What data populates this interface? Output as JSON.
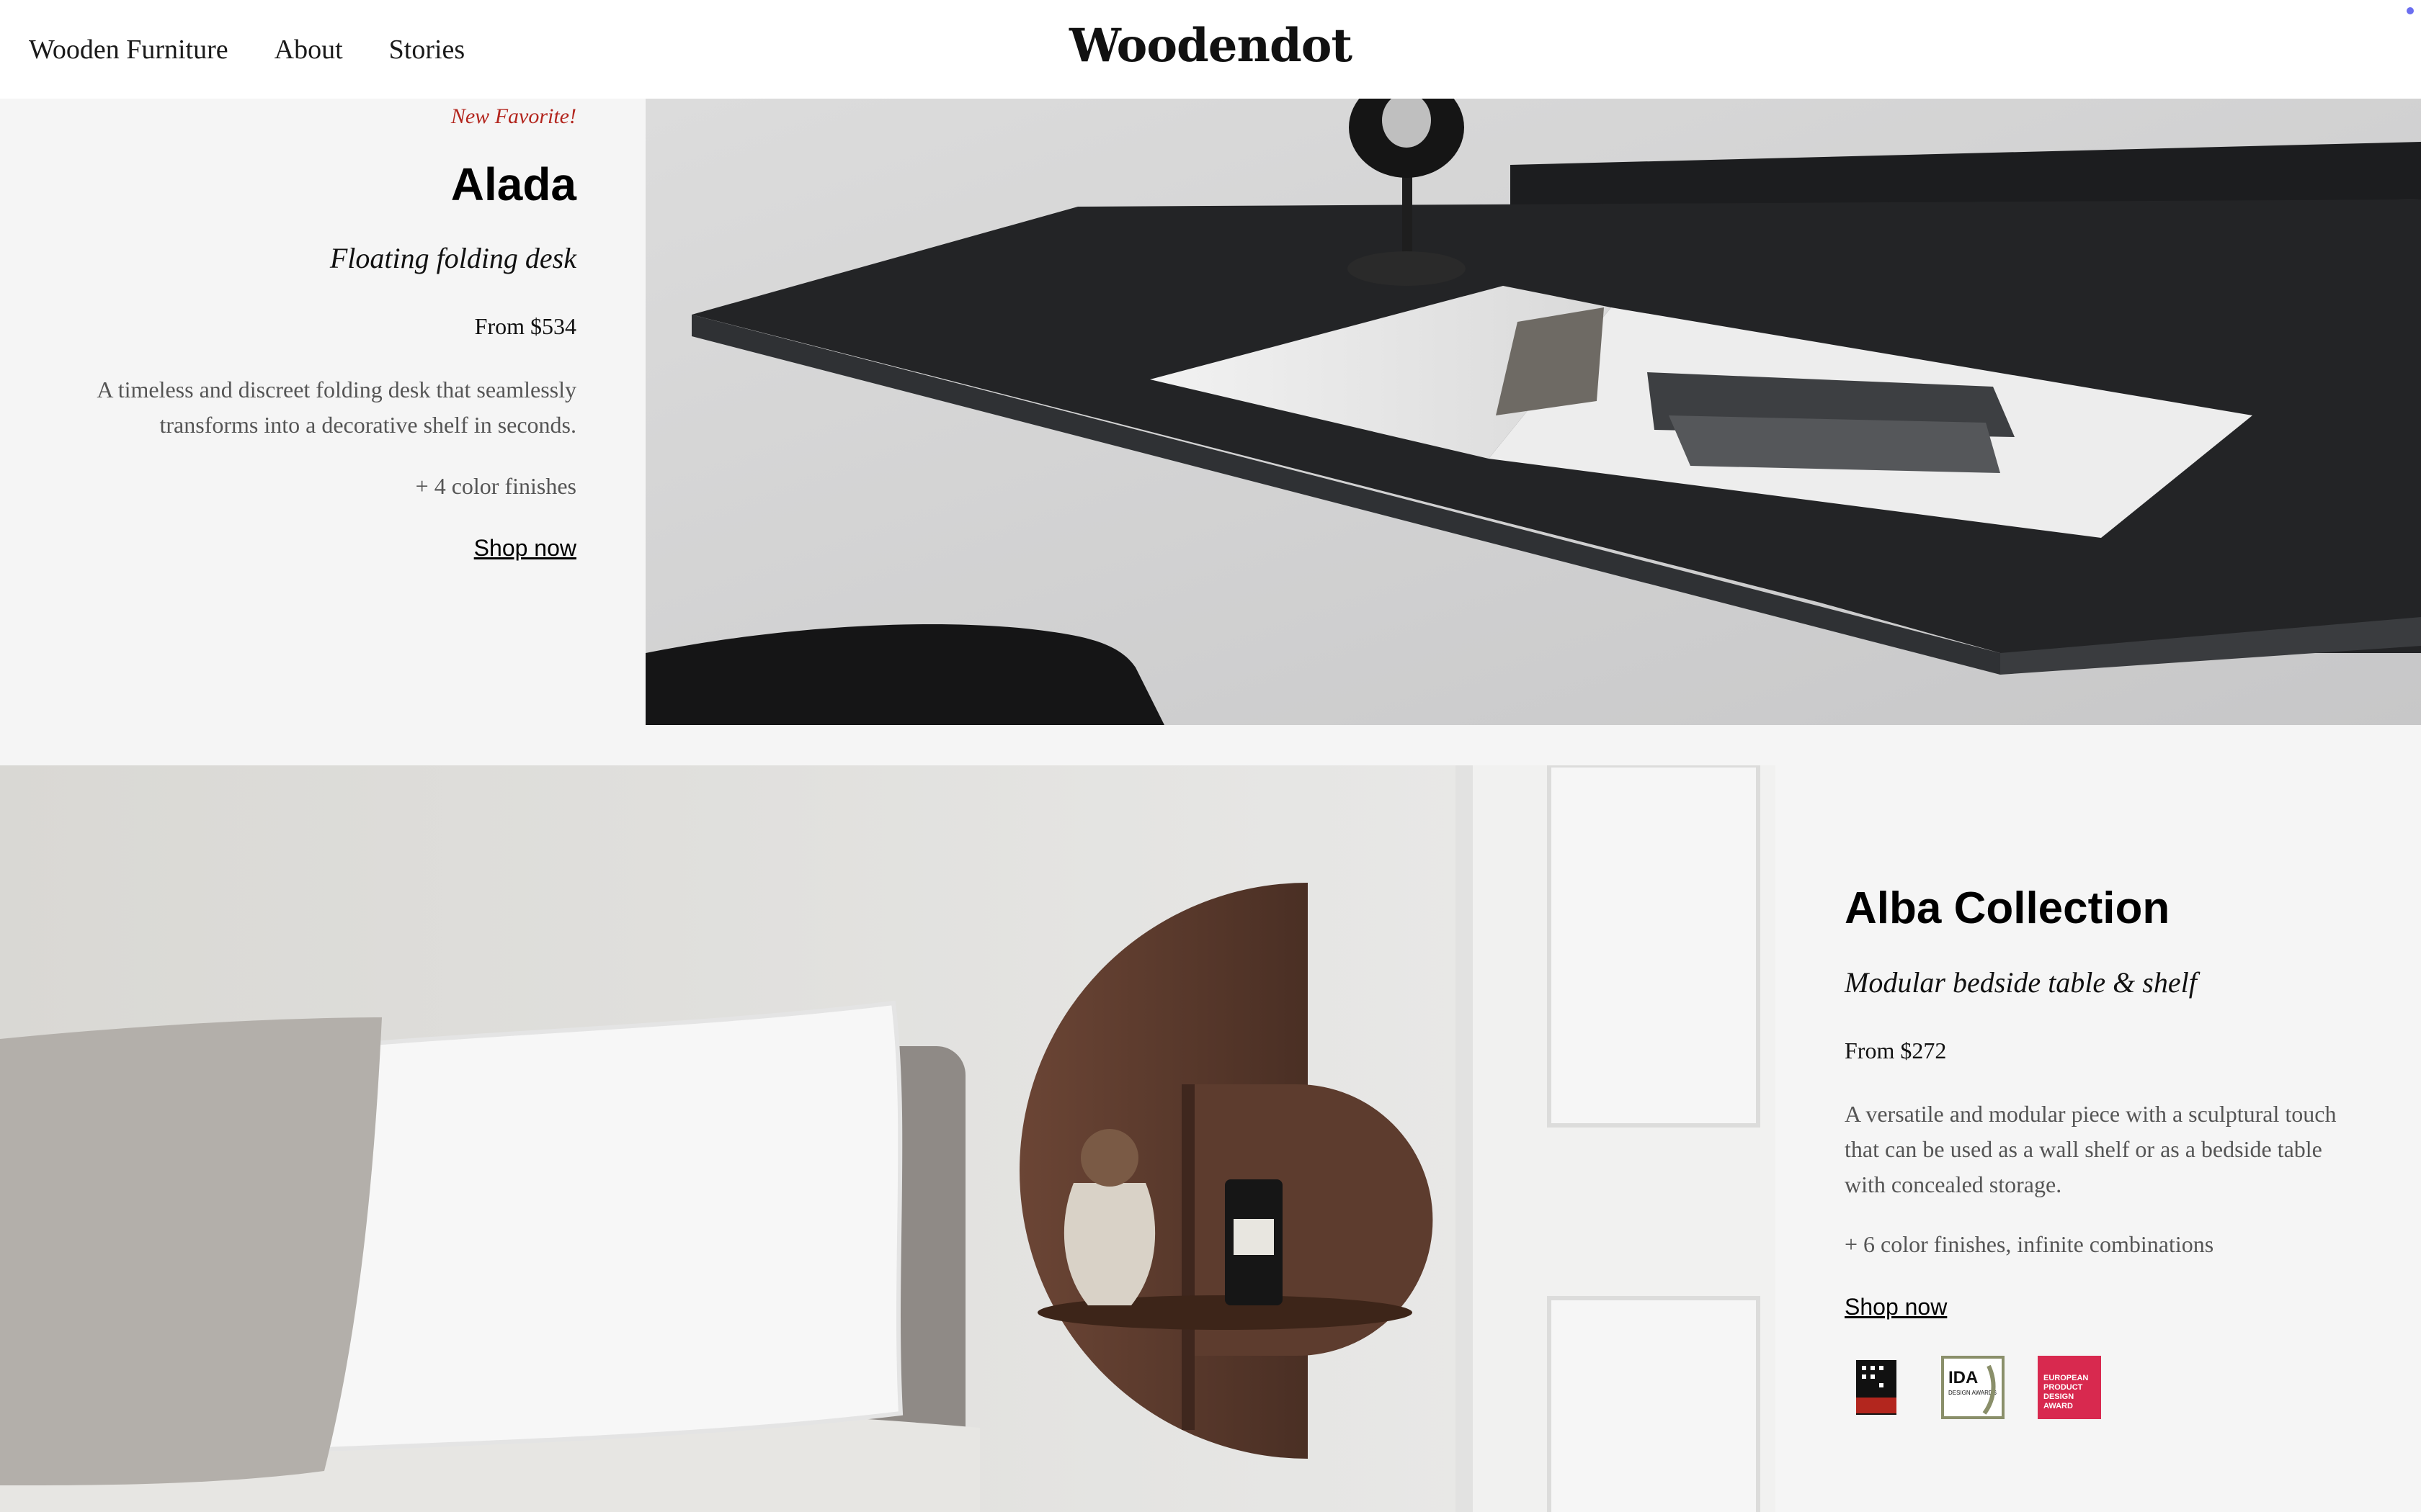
{
  "header": {
    "nav": [
      "Wooden Furniture",
      "About",
      "Stories"
    ],
    "logo": "Woodendot"
  },
  "alada": {
    "tag": "New Favorite!",
    "title": "Alada",
    "subtitle": "Floating folding desk",
    "price": "From $534",
    "description": "A timeless and discreet folding desk that seamlessly transforms into a decorative shelf in seconds.",
    "finishes": "+ 4 color finishes",
    "cta": "Shop now"
  },
  "alba": {
    "title": "Alba Collection",
    "subtitle": "Modular bedside table & shelf",
    "price": "From $272",
    "description": "A versatile and modular piece with a sculptural touch that can be used as a wall shelf or as a bedside table with concealed storage.",
    "finishes": "+ 6 color finishes, infinite combinations",
    "cta": "Shop now",
    "awards": [
      {
        "icon": "design-award-badge-icon",
        "color": "#111111"
      },
      {
        "icon": "ida-design-awards-badge-icon",
        "text": "IDA",
        "subtext": "DESIGN AWARDS",
        "color": "#8a8f6a"
      },
      {
        "icon": "european-product-design-award-icon",
        "text": "EUROPEAN PRODUCT DESIGN AWARD",
        "color": "#d8294f"
      }
    ]
  },
  "colors": {
    "tag": "#b3261e",
    "background": "#f5f5f5",
    "desk": "#1d1e20",
    "walnut": "#5a3a2c"
  }
}
